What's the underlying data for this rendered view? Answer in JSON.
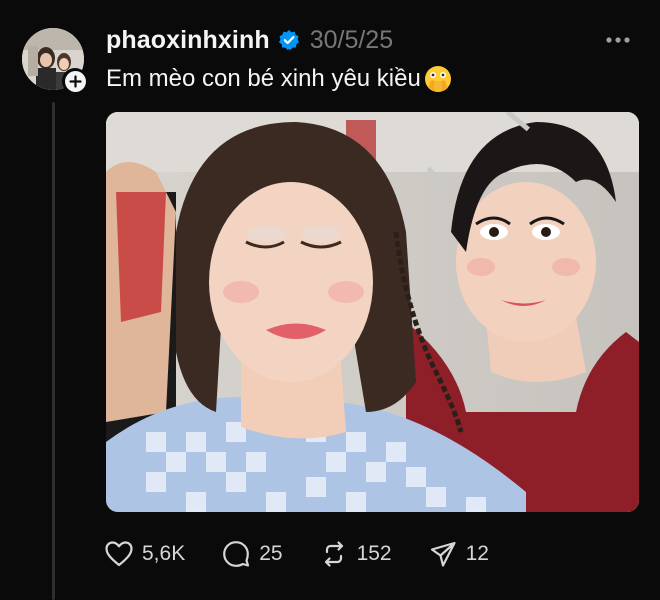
{
  "post": {
    "username": "phaoxinhxinh",
    "timestamp": "30/5/25",
    "caption": "Em mèo con bé xinh yêu kiều",
    "caption_emoji": "face-with-open-eyes-and-hand-over-mouth",
    "verified": true
  },
  "actions": {
    "likes": "5,6K",
    "replies": "25",
    "reposts": "152",
    "shares": "12"
  },
  "icons": {
    "avatar": "avatar",
    "follow": "plus-icon",
    "verified": "verified-badge-icon",
    "more": "more-options-icon",
    "like": "heart-icon",
    "reply": "comment-icon",
    "repost": "repost-icon",
    "share": "send-icon"
  },
  "colors": {
    "background": "#0a0a0a",
    "text": "#f3f5f7",
    "muted": "#777777",
    "verified": "#0095f6"
  }
}
